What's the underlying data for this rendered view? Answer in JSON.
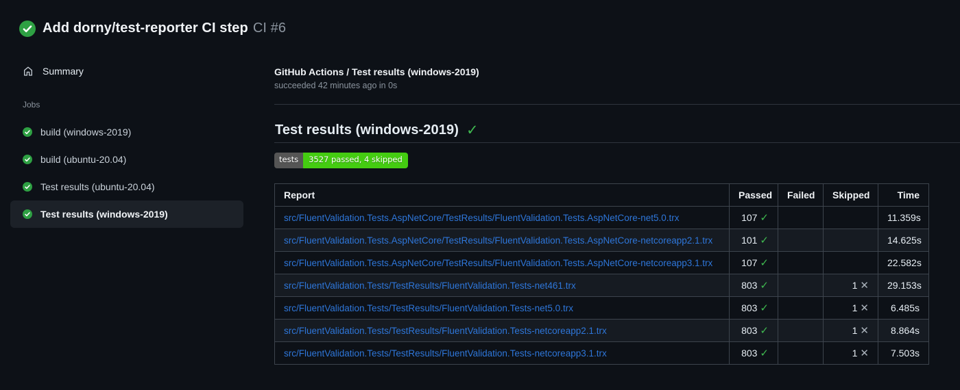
{
  "run_header": {
    "title": "Add dorny/test-reporter CI step",
    "run_number": "CI #6",
    "status": "success"
  },
  "sidebar": {
    "summary_label": "Summary",
    "jobs_label": "Jobs",
    "jobs": [
      {
        "label": "build (windows-2019)",
        "status": "success",
        "selected": false
      },
      {
        "label": "build (ubuntu-20.04)",
        "status": "success",
        "selected": false
      },
      {
        "label": "Test results (ubuntu-20.04)",
        "status": "success",
        "selected": false
      },
      {
        "label": "Test results (windows-2019)",
        "status": "success",
        "selected": true
      }
    ]
  },
  "main": {
    "check_header": {
      "title": "GitHub Actions / Test results (windows-2019)",
      "subtitle": "succeeded 42 minutes ago in 0s"
    },
    "section": {
      "heading": "Test results (windows-2019)",
      "heading_status": "success"
    },
    "badge": {
      "label": "tests",
      "value": "3527 passed, 4 skipped"
    },
    "table": {
      "columns": [
        "Report",
        "Passed",
        "Failed",
        "Skipped",
        "Time"
      ],
      "rows": [
        {
          "report": "src/FluentValidation.Tests.AspNetCore/TestResults/FluentValidation.Tests.AspNetCore-net5.0.trx",
          "passed": "107",
          "failed": "",
          "skipped": "",
          "time": "11.359s"
        },
        {
          "report": "src/FluentValidation.Tests.AspNetCore/TestResults/FluentValidation.Tests.AspNetCore-netcoreapp2.1.trx",
          "passed": "101",
          "failed": "",
          "skipped": "",
          "time": "14.625s"
        },
        {
          "report": "src/FluentValidation.Tests.AspNetCore/TestResults/FluentValidation.Tests.AspNetCore-netcoreapp3.1.trx",
          "passed": "107",
          "failed": "",
          "skipped": "",
          "time": "22.582s"
        },
        {
          "report": "src/FluentValidation.Tests/TestResults/FluentValidation.Tests-net461.trx",
          "passed": "803",
          "failed": "",
          "skipped": "1",
          "time": "29.153s"
        },
        {
          "report": "src/FluentValidation.Tests/TestResults/FluentValidation.Tests-net5.0.trx",
          "passed": "803",
          "failed": "",
          "skipped": "1",
          "time": "6.485s"
        },
        {
          "report": "src/FluentValidation.Tests/TestResults/FluentValidation.Tests-netcoreapp2.1.trx",
          "passed": "803",
          "failed": "",
          "skipped": "1",
          "time": "8.864s"
        },
        {
          "report": "src/FluentValidation.Tests/TestResults/FluentValidation.Tests-netcoreapp3.1.trx",
          "passed": "803",
          "failed": "",
          "skipped": "1",
          "time": "7.503s"
        }
      ]
    }
  },
  "colors": {
    "background": "#0d1117",
    "selected_item_bg": "#1c2128",
    "link_blue": "#2e76d9",
    "success_green": "#3fb950",
    "icon_green": "#2ea043",
    "badge_label_bg": "#555555",
    "badge_value_bg": "#44cc11",
    "table_border": "#3d444d"
  },
  "icons": {
    "run_status": "check-circle-icon",
    "summary": "home-icon",
    "job_status": "check-circle-icon",
    "passed": "check-icon",
    "skipped": "x-icon"
  }
}
